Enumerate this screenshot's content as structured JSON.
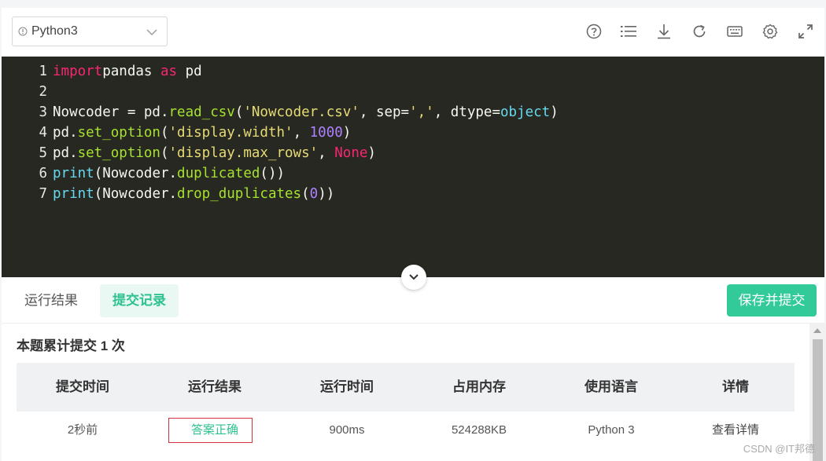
{
  "toolbar": {
    "language": "Python3",
    "icons": [
      "help-icon",
      "list-icon",
      "download-icon",
      "refresh-icon",
      "keyboard-icon",
      "gear-icon",
      "fullscreen-icon"
    ]
  },
  "editor": {
    "lines": [
      {
        "num": "1",
        "tokens": [
          [
            "kw",
            "import"
          ],
          [
            "",
            "pandas"
          ],
          [
            "kw",
            " as"
          ],
          [
            "",
            " pd"
          ]
        ]
      },
      {
        "num": "2",
        "tokens": []
      },
      {
        "num": "3",
        "tokens": [
          [
            "",
            "Nowcoder = pd."
          ],
          [
            "fn",
            "read_csv"
          ],
          [
            "",
            "("
          ],
          [
            "str",
            "'Nowcoder.csv'"
          ],
          [
            "",
            ", sep="
          ],
          [
            "str",
            "','"
          ],
          [
            "",
            ", dtype="
          ],
          [
            "bi",
            "object"
          ],
          [
            "",
            ")"
          ]
        ]
      },
      {
        "num": "4",
        "tokens": [
          [
            "",
            "pd."
          ],
          [
            "fn",
            "set_option"
          ],
          [
            "",
            "("
          ],
          [
            "str",
            "'display.width'"
          ],
          [
            "",
            ", "
          ],
          [
            "num",
            "1000"
          ],
          [
            "",
            ")"
          ]
        ]
      },
      {
        "num": "5",
        "tokens": [
          [
            "",
            "pd."
          ],
          [
            "fn",
            "set_option"
          ],
          [
            "",
            "("
          ],
          [
            "str",
            "'display.max_rows'"
          ],
          [
            "",
            ", "
          ],
          [
            "kw",
            "None"
          ],
          [
            "",
            ")"
          ]
        ]
      },
      {
        "num": "6",
        "tokens": [
          [
            "bi",
            "print"
          ],
          [
            "",
            "(Nowcoder."
          ],
          [
            "fn",
            "duplicated"
          ],
          [
            "",
            "())"
          ]
        ]
      },
      {
        "num": "7",
        "tokens": [
          [
            "bi",
            "print"
          ],
          [
            "",
            "(Nowcoder."
          ],
          [
            "fn",
            "drop_duplicates"
          ],
          [
            "",
            "("
          ],
          [
            "num",
            "0"
          ],
          [
            "",
            "))"
          ]
        ]
      }
    ]
  },
  "tabs": {
    "run_result": "运行结果",
    "submissions": "提交记录",
    "save_submit": "保存并提交"
  },
  "results": {
    "count_text": "本题累计提交 1 次",
    "headers": [
      "提交时间",
      "运行结果",
      "运行时间",
      "占用内存",
      "使用语言",
      "详情"
    ],
    "row": {
      "time": "2秒前",
      "status": "答案正确",
      "runtime": "900ms",
      "memory": "524288KB",
      "language": "Python 3",
      "detail": "查看详情"
    }
  },
  "watermark": "CSDN @IT邦德"
}
